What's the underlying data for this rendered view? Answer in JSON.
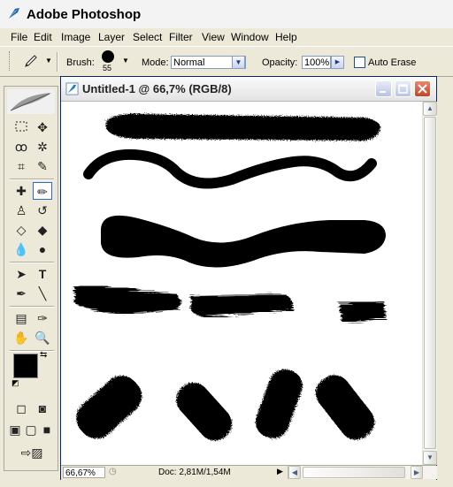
{
  "app": {
    "title": "Adobe Photoshop"
  },
  "menu": [
    "File",
    "Edit",
    "Image",
    "Layer",
    "Select",
    "Filter",
    "View",
    "Window",
    "Help"
  ],
  "options": {
    "brush_label": "Brush:",
    "brush_size": "55",
    "mode_label": "Mode:",
    "mode_value": "Normal",
    "opacity_label": "Opacity:",
    "opacity_value": "100%",
    "auto_erase_label": "Auto Erase",
    "auto_erase_checked": false
  },
  "document": {
    "title": "Untitled-1 @ 66,7% (RGB/8)",
    "zoom": "66,67%",
    "doc_info": "Doc: 2,81M/1,54M"
  },
  "toolbox": {
    "foreground_color": "#000000",
    "background_color": "#ffffff",
    "active_tool": "pencil"
  },
  "colors": {
    "title_close": "#c24624",
    "selection_border": "#316ac5"
  }
}
